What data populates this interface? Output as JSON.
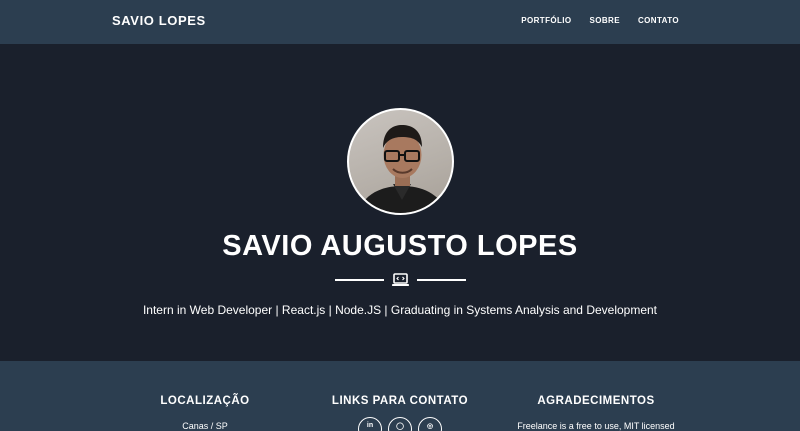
{
  "navbar": {
    "brand": "SAVIO LOPES",
    "links": [
      "PORTFÓLIO",
      "SOBRE",
      "CONTATO"
    ]
  },
  "masthead": {
    "name": "SAVIO AUGUSTO LOPES",
    "subtitle": "Intern in Web Developer | React.js | Node.JS | Graduating in Systems Analysis and Development",
    "divider_icon": "laptop-code-icon"
  },
  "footer": {
    "location": {
      "title": "LOCALIZAÇÃO",
      "text": "Canas / SP"
    },
    "contact": {
      "title": "LINKS PARA CONTATO",
      "icons": [
        "linkedin-icon",
        "github-icon",
        "dribbble-icon"
      ],
      "icon_glyphs": [
        "in",
        "◯",
        "◎"
      ]
    },
    "thanks": {
      "title": "AGRADECIMENTOS",
      "text": "Freelance is a free to use, MIT licensed"
    }
  },
  "colors": {
    "navbar": "#2c3e50",
    "masthead": "#1a202c",
    "footer": "#2c3e50",
    "text": "#ffffff"
  }
}
